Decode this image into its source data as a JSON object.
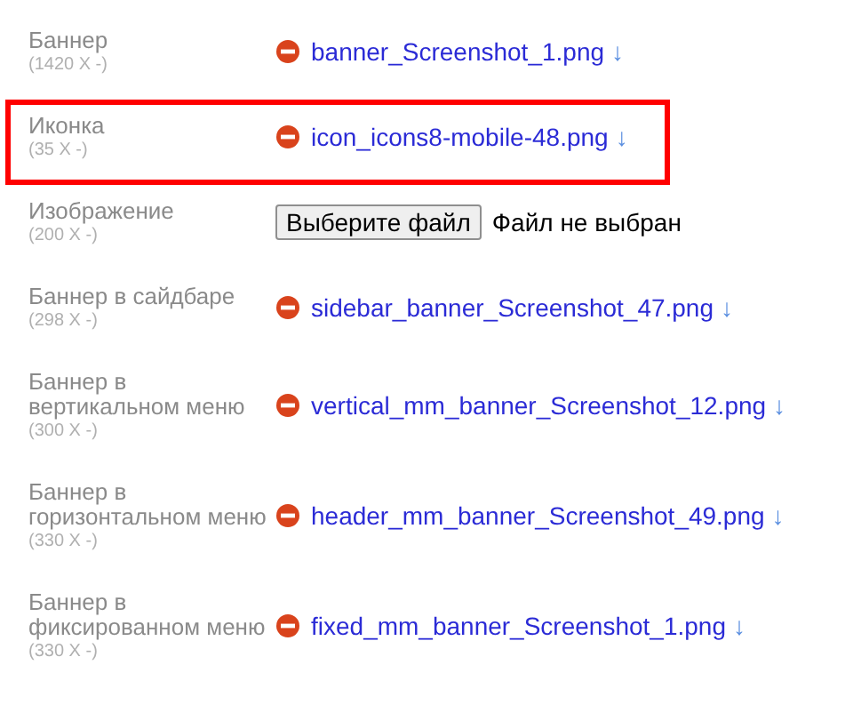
{
  "fields": [
    {
      "label": "Баннер",
      "size": "(1420 X -)",
      "kind": "file",
      "filename": "banner_Screenshot_1.png",
      "download": "↓",
      "highlighted": false
    },
    {
      "label": "Иконка",
      "size": "(35 X -)",
      "kind": "file",
      "filename": "icon_icons8-mobile-48.png",
      "download": "↓",
      "highlighted": true
    },
    {
      "label": "Изображение",
      "size": "(200 X -)",
      "kind": "upload",
      "button": "Выберите файл",
      "status": "Файл не выбран",
      "highlighted": false
    },
    {
      "label": "Баннер в сайдбаре",
      "size": "(298 X -)",
      "kind": "file",
      "filename": "sidebar_banner_Screenshot_47.png",
      "download": "↓",
      "highlighted": false
    },
    {
      "label": "Баннер в вертикальном меню",
      "size": "(300 X -)",
      "kind": "file",
      "filename": "vertical_mm_banner_Screenshot_12.png",
      "download": "↓",
      "highlighted": false
    },
    {
      "label": "Баннер в горизонтальном меню",
      "size": "(330 X -)",
      "kind": "file",
      "filename": "header_mm_banner_Screenshot_49.png",
      "download": "↓",
      "highlighted": false
    },
    {
      "label": "Баннер в фиксированном меню",
      "size": "(330 X -)",
      "kind": "file",
      "filename": "fixed_mm_banner_Screenshot_1.png",
      "download": "↓",
      "highlighted": false
    }
  ]
}
